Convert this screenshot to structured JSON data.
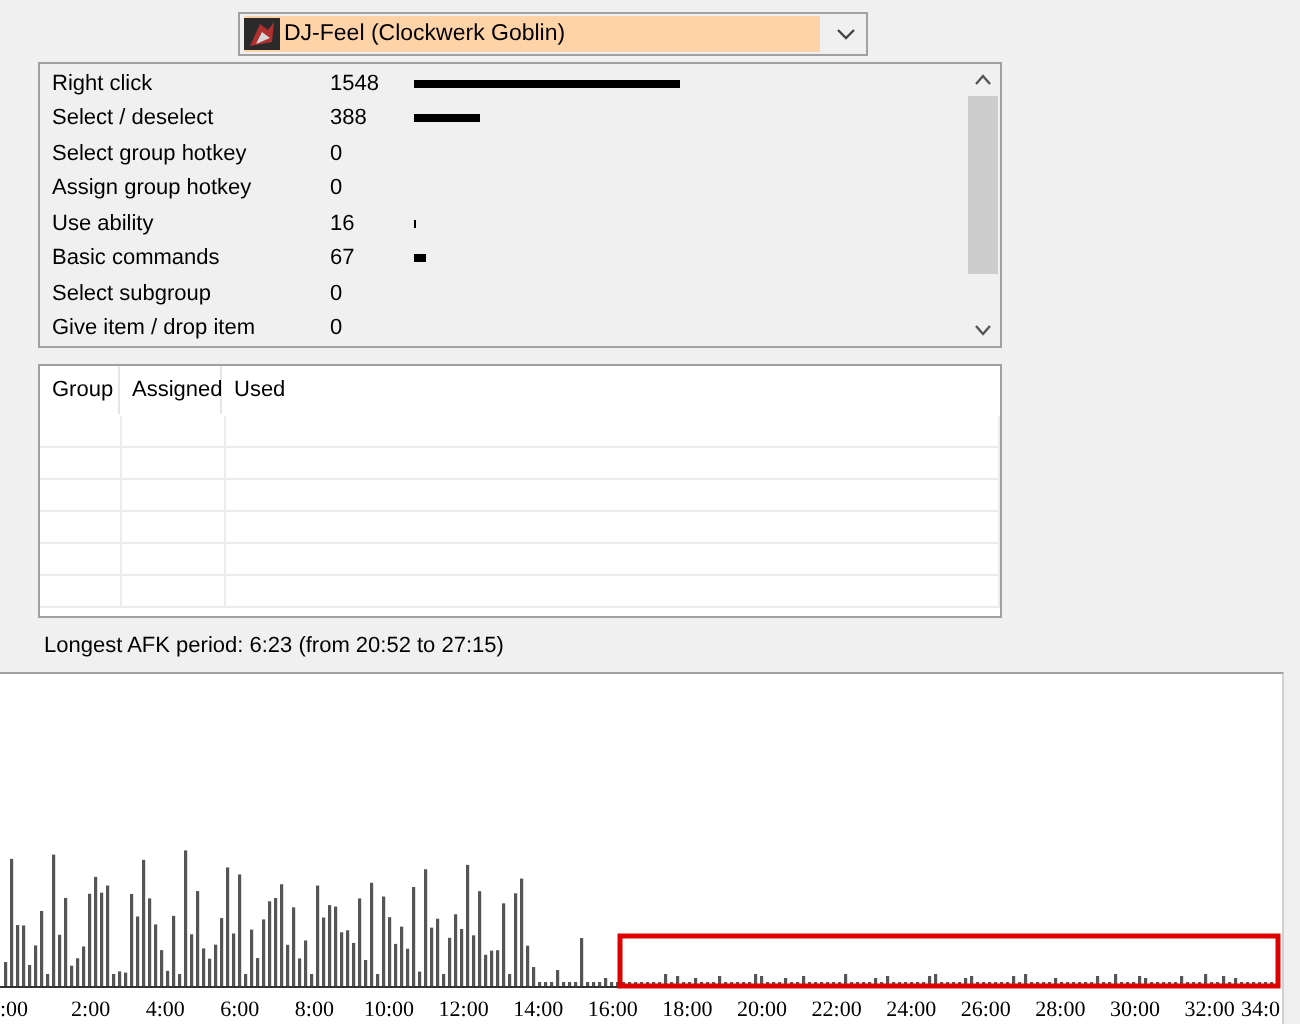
{
  "hero_select": {
    "value": "DJ-Feel (Clockwerk Goblin)"
  },
  "actions": [
    {
      "name": "Right click",
      "count": "1548"
    },
    {
      "name": "Select / deselect",
      "count": "388"
    },
    {
      "name": "Select group hotkey",
      "count": "0"
    },
    {
      "name": "Assign group hotkey",
      "count": "0"
    },
    {
      "name": "Use ability",
      "count": "16"
    },
    {
      "name": "Basic commands",
      "count": "67"
    },
    {
      "name": "Select subgroup",
      "count": "0"
    },
    {
      "name": "Give item / drop item",
      "count": "0"
    }
  ],
  "groups_table": {
    "columns": [
      "Group",
      "Assigned",
      "Used"
    ]
  },
  "afk_text": "Longest AFK period: 6:23 (from 20:52 to 27:15)",
  "timeline": {
    "highlight": true,
    "x_labels": [
      ":00",
      "2:00",
      "4:00",
      "6:00",
      "8:00",
      "10:00",
      "12:00",
      "14:00",
      "16:00",
      "18:00",
      "20:00",
      "22:00",
      "24:00",
      "26:00",
      "28:00",
      "30:00",
      "32:00",
      "34:0"
    ]
  }
}
